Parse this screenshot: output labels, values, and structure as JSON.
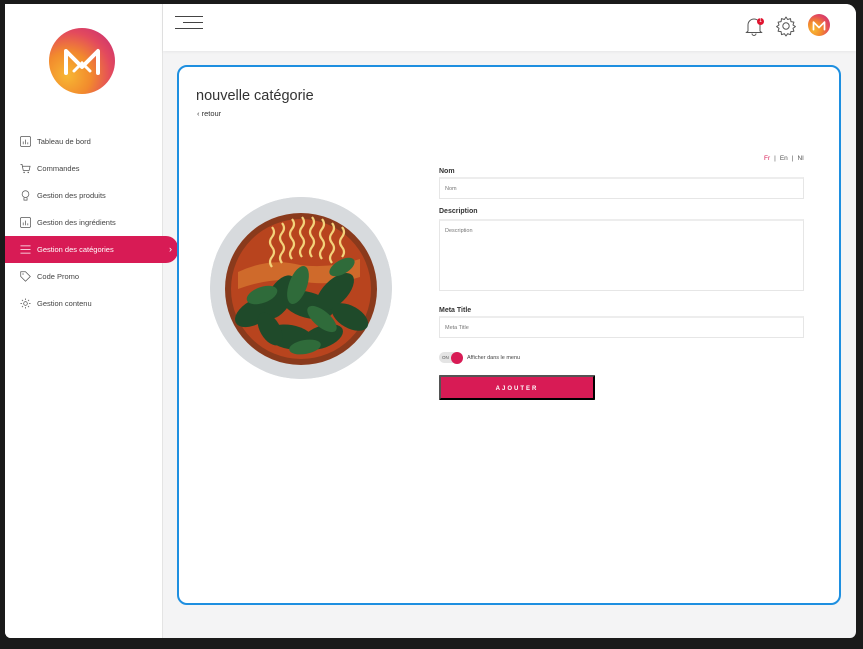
{
  "sidebar": {
    "items": [
      {
        "label": "Tableau de bord",
        "icon": "chart-icon",
        "active": false
      },
      {
        "label": "Commandes",
        "icon": "cart-icon",
        "active": false
      },
      {
        "label": "Gestion des produits",
        "icon": "lightbulb-icon",
        "active": false
      },
      {
        "label": "Gestion des ingrédients",
        "icon": "chart-icon",
        "active": false
      },
      {
        "label": "Gestion des catégories",
        "icon": "menu-lines-icon",
        "active": true
      },
      {
        "label": "Code Promo",
        "icon": "tag-icon",
        "active": false
      },
      {
        "label": "Gestion contenu",
        "icon": "gear-icon",
        "active": false
      }
    ]
  },
  "header": {
    "notifications_count": "1"
  },
  "main": {
    "title": "nouvelle catégorie",
    "back_label": "‹ retour",
    "languages": [
      "Fr",
      "En",
      "Nl"
    ],
    "active_language": "Fr",
    "form": {
      "name_label": "Nom",
      "name_placeholder": "Nom",
      "description_label": "Description",
      "description_placeholder": "Description",
      "meta_label": "Meta Title",
      "meta_placeholder": "Meta Title",
      "toggle_state": "ON",
      "toggle_label": "Afficher dans le menu",
      "submit_label": "AJOUTER"
    }
  },
  "colors": {
    "accent": "#d81b55",
    "card_border": "#1e8fe0",
    "background": "#f4f4f5"
  }
}
